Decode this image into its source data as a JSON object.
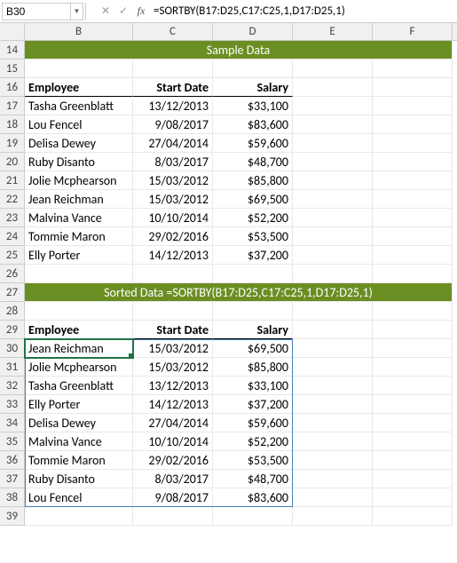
{
  "nameBox": "B30",
  "formula": "=SORTBY(B17:D25,C17:C25,1,D17:D25,1)",
  "fxCancel": "✕",
  "fxConfirm": "✓",
  "fxLabel": "fx",
  "columns": [
    "B",
    "C",
    "D",
    "E",
    "F"
  ],
  "rowStart": 14,
  "rowEnd": 39,
  "banner1": "Sample Data",
  "banner2": "Sorted Data =SORTBY(B17:D25,C17:C25,1,D17:D25,1)",
  "headers": {
    "emp": "Employee",
    "date": "Start Date",
    "sal": "Salary"
  },
  "sample": [
    {
      "emp": "Tasha Greenblatt",
      "date": "13/12/2013",
      "sal": "$33,100"
    },
    {
      "emp": "Lou Fencel",
      "date": "9/08/2017",
      "sal": "$83,600"
    },
    {
      "emp": "Delisa Dewey",
      "date": "27/04/2014",
      "sal": "$59,600"
    },
    {
      "emp": "Ruby Disanto",
      "date": "8/03/2017",
      "sal": "$48,700"
    },
    {
      "emp": "Jolie Mcphearson",
      "date": "15/03/2012",
      "sal": "$85,800"
    },
    {
      "emp": "Jean Reichman",
      "date": "15/03/2012",
      "sal": "$69,500"
    },
    {
      "emp": "Malvina Vance",
      "date": "10/10/2014",
      "sal": "$52,200"
    },
    {
      "emp": "Tommie Maron",
      "date": "29/02/2016",
      "sal": "$53,500"
    },
    {
      "emp": "Elly Porter",
      "date": "14/12/2013",
      "sal": "$37,200"
    }
  ],
  "sorted": [
    {
      "emp": "Jean Reichman",
      "date": "15/03/2012",
      "sal": "$69,500"
    },
    {
      "emp": "Jolie Mcphearson",
      "date": "15/03/2012",
      "sal": "$85,800"
    },
    {
      "emp": "Tasha Greenblatt",
      "date": "13/12/2013",
      "sal": "$33,100"
    },
    {
      "emp": "Elly Porter",
      "date": "14/12/2013",
      "sal": "$37,200"
    },
    {
      "emp": "Delisa Dewey",
      "date": "27/04/2014",
      "sal": "$59,600"
    },
    {
      "emp": "Malvina Vance",
      "date": "10/10/2014",
      "sal": "$52,200"
    },
    {
      "emp": "Tommie Maron",
      "date": "29/02/2016",
      "sal": "$53,500"
    },
    {
      "emp": "Ruby Disanto",
      "date": "8/03/2017",
      "sal": "$48,700"
    },
    {
      "emp": "Lou Fencel",
      "date": "9/08/2017",
      "sal": "$83,600"
    }
  ],
  "chart_data": {
    "type": "table",
    "title": "Sample Data sorted by Start Date then Salary",
    "columns": [
      "Employee",
      "Start Date",
      "Salary"
    ],
    "sample_rows": [
      [
        "Tasha Greenblatt",
        "13/12/2013",
        33100
      ],
      [
        "Lou Fencel",
        "9/08/2017",
        83600
      ],
      [
        "Delisa Dewey",
        "27/04/2014",
        59600
      ],
      [
        "Ruby Disanto",
        "8/03/2017",
        48700
      ],
      [
        "Jolie Mcphearson",
        "15/03/2012",
        85800
      ],
      [
        "Jean Reichman",
        "15/03/2012",
        69500
      ],
      [
        "Malvina Vance",
        "10/10/2014",
        52200
      ],
      [
        "Tommie Maron",
        "29/02/2016",
        53500
      ],
      [
        "Elly Porter",
        "14/12/2013",
        37200
      ]
    ],
    "sorted_rows": [
      [
        "Jean Reichman",
        "15/03/2012",
        69500
      ],
      [
        "Jolie Mcphearson",
        "15/03/2012",
        85800
      ],
      [
        "Tasha Greenblatt",
        "13/12/2013",
        33100
      ],
      [
        "Elly Porter",
        "14/12/2013",
        37200
      ],
      [
        "Delisa Dewey",
        "27/04/2014",
        59600
      ],
      [
        "Malvina Vance",
        "10/10/2014",
        52200
      ],
      [
        "Tommie Maron",
        "29/02/2016",
        53500
      ],
      [
        "Ruby Disanto",
        "8/03/2017",
        48700
      ],
      [
        "Lou Fencel",
        "9/08/2017",
        83600
      ]
    ]
  }
}
